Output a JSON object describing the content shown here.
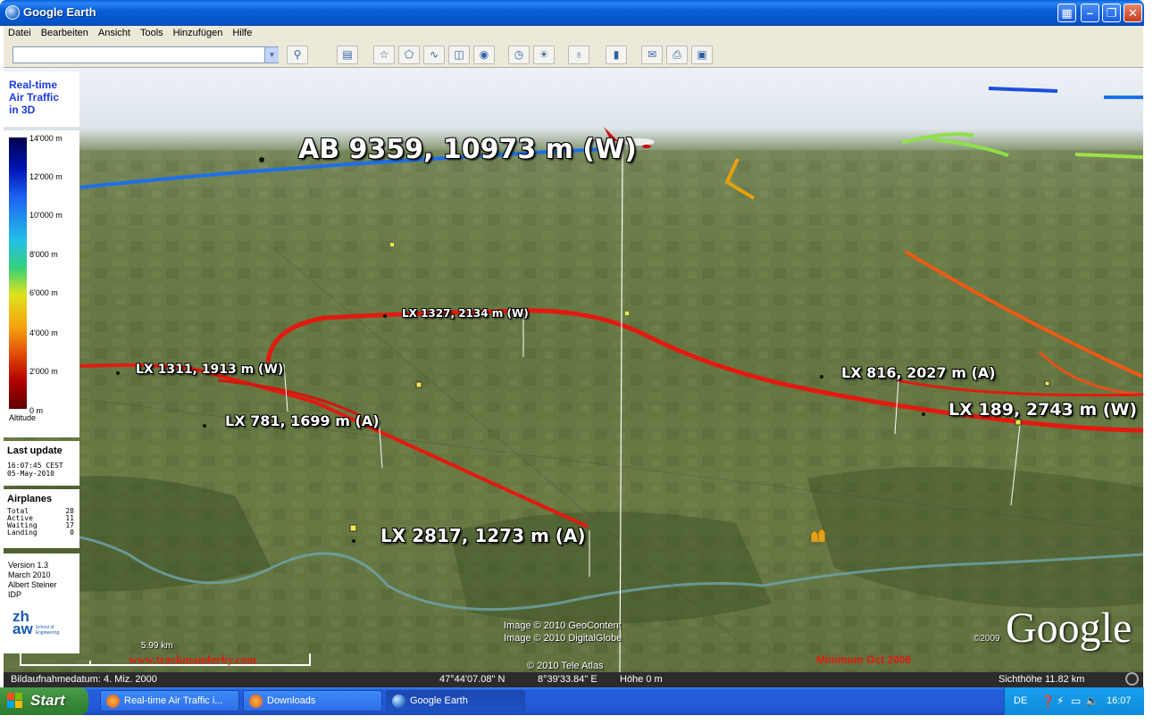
{
  "window": {
    "title": "Google Earth"
  },
  "menu": [
    "Datei",
    "Bearbeiten",
    "Ansicht",
    "Tools",
    "Hinzufügen",
    "Hilfe"
  ],
  "search": {
    "value": ""
  },
  "toolbar_icons": [
    "search-icon",
    "sidebar-icon",
    "placemark-icon",
    "polygon-icon",
    "path-icon",
    "image-overlay-icon",
    "record-tour-icon",
    "historical-imagery-icon",
    "sunlight-icon",
    "planets-icon",
    "ruler-icon",
    "email-icon",
    "print-icon",
    "show-in-maps-icon"
  ],
  "panel": {
    "brand": "Real-time\nAir Traffic\nin 3D",
    "legend": {
      "ticks": [
        "14'000 m",
        "12'000 m",
        "10'000 m",
        "8'000 m",
        "6'000 m",
        "4'000 m",
        "2'000 m",
        "0 m"
      ],
      "label": "Altitude"
    },
    "last_update": {
      "heading": "Last update",
      "time": "16:07:45 CEST",
      "date": "05-May-2010"
    },
    "airplanes": {
      "heading": "Airplanes",
      "rows": [
        {
          "label": "Total",
          "value": "28"
        },
        {
          "label": "Active",
          "value": "11"
        },
        {
          "label": "Waiting",
          "value": "17"
        },
        {
          "label": "Landing",
          "value": "0"
        }
      ]
    },
    "info": {
      "version": "Version 1.3",
      "date": "March 2010",
      "author": "Albert Steiner",
      "org": "IDP",
      "logo_text": "zh\naw",
      "logo_sub": "School of\nEngineering"
    }
  },
  "flights": [
    {
      "label": "AB 9359, 10973 m (W)"
    },
    {
      "label": "LX 1327, 2134 m (W)"
    },
    {
      "label": "LX 1311, 1913 m (W)"
    },
    {
      "label": "LX 781, 1699 m (A)"
    },
    {
      "label": "LX 2817, 1273 m (A)"
    },
    {
      "label": "LX 816, 2027 m (A)"
    },
    {
      "label": "LX 189, 2743 m (W)"
    }
  ],
  "map": {
    "credits": [
      "Image © 2010 GeoContent",
      "Image © 2010 DigitalGlobe",
      "© 2010 Tele Atlas"
    ],
    "copyright_year": "©2009",
    "logo": "Google",
    "scale": "5.99 km",
    "watermark_left": "www.trackmanderby.com",
    "watermark_right": "Minimum Oct 2006"
  },
  "status": {
    "date": "Bildaufnahmedatum: 4. Miz. 2000",
    "lat": "47°44'07.08\" N",
    "lon": "8°39'33.84\" E",
    "elev": "Höhe  0 m",
    "eye": "Sichthöhe   11.82 km"
  },
  "taskbar": {
    "start": "Start",
    "tasks": [
      "Real-time Air Traffic i...",
      "Downloads",
      "Google Earth"
    ],
    "lang": "DE",
    "clock": "16:07"
  },
  "colors": {
    "route_red": "#e21a10",
    "route_orange": "#ec5a14",
    "route_blue": "#1e6fe8",
    "route_green": "#8fe04a",
    "route_yellow": "#e8a010"
  }
}
